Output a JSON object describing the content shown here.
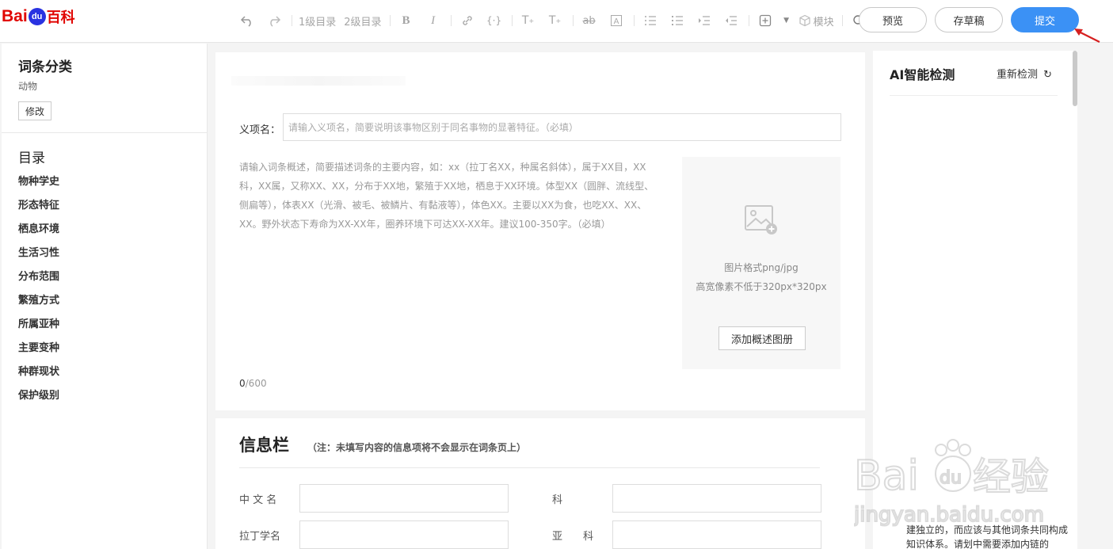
{
  "logo": {
    "bai": "Bai",
    "du": "du",
    "cn": "百科"
  },
  "toolbar": {
    "heading1": "1级目录",
    "heading2": "2级目录",
    "module": "模块"
  },
  "header_buttons": {
    "preview": "预览",
    "save_draft": "存草稿",
    "submit": "提交"
  },
  "sidebar": {
    "category_title": "词条分类",
    "category_value": "动物",
    "edit_label": "修改",
    "toc_title": "目录",
    "toc_items": [
      "物种学史",
      "形态特征",
      "栖息环境",
      "生活习性",
      "分布范围",
      "繁殖方式",
      "所属亚种",
      "主要变种",
      "种群现状",
      "保护级别"
    ]
  },
  "editor": {
    "sense_label": "义项名：",
    "sense_placeholder": "请输入义项名，简要说明该事物区别于同名事物的显著特征。（必填）",
    "summary_placeholder": "请输入词条概述，简要描述词条的主要内容，如：xx（拉丁名XX，种属名斜体），属于XX目，XX科，XX属，又称XX、XX，分布于XX地，繁殖于XX地，栖息于XX环境。体型XX（圆胖、流线型、侧扁等），体表XX（光滑、被毛、被鳞片、有黏液等），体色XX。主要以XX为食，也吃XX、XX、XX。野外状态下寿命为XX-XX年，圈养环境下可达XX-XX年。建议100-350字。（必填）",
    "count_current": "0",
    "count_max": "/600",
    "image_format": "图片格式png/jpg",
    "image_size": "高宽像素不低于320px*320px",
    "add_image_button": "添加概述图册"
  },
  "infobox": {
    "title": "信息栏",
    "note": "（注：未填写内容的信息项将不会显示在词条页上）",
    "fields": {
      "chinese_name": "中 文 名",
      "family": "科",
      "latin_name": "拉丁学名",
      "subfamily": "亚　　科"
    }
  },
  "ai_panel": {
    "title": "AI智能检测",
    "recheck": "重新检测",
    "text": "建独立的，而应该与其他词条共同构成知识体系。请划中需要添加内链的"
  },
  "colors": {
    "brand_red": "#e10602",
    "brand_blue": "#2932e1",
    "submit_blue": "#3b91f5"
  }
}
